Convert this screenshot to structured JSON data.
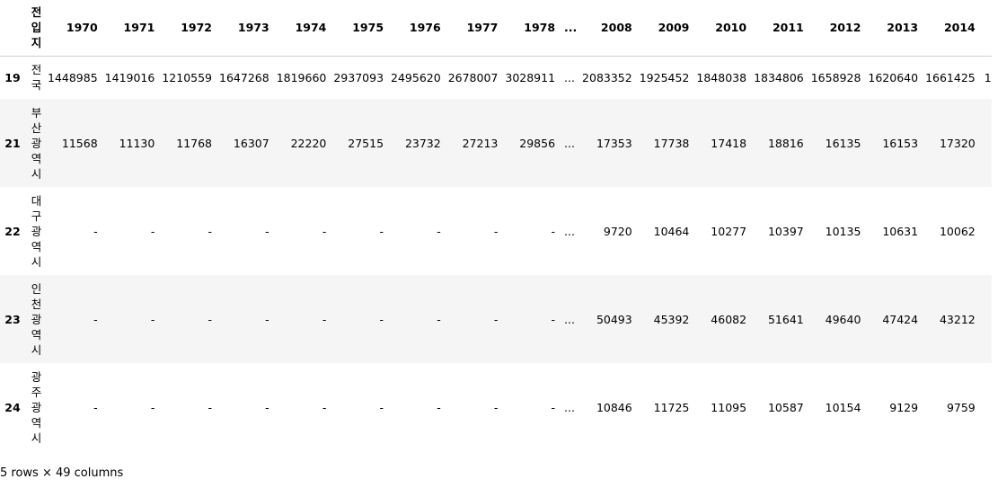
{
  "table": {
    "index_header": "",
    "name_header": "전입지",
    "columns_left": [
      "1970",
      "1971",
      "1972",
      "1973",
      "1974",
      "1975",
      "1976",
      "1977",
      "1978"
    ],
    "ellipsis": "...",
    "columns_right": [
      "2008",
      "2009",
      "2010",
      "2011",
      "2012",
      "2013",
      "2014"
    ],
    "rows": [
      {
        "index": "19",
        "name": "전국",
        "left": [
          "1448985",
          "1419016",
          "1210559",
          "1647268",
          "1819660",
          "2937093",
          "2495620",
          "2678007",
          "3028911"
        ],
        "right": [
          "2083352",
          "1925452",
          "1848038",
          "1834806",
          "1658928",
          "1620640",
          "1661425"
        ],
        "overflow": "1"
      },
      {
        "index": "21",
        "name": "부산광역시",
        "left": [
          "11568",
          "11130",
          "11768",
          "16307",
          "22220",
          "27515",
          "23732",
          "27213",
          "29856"
        ],
        "right": [
          "17353",
          "17738",
          "17418",
          "18816",
          "16135",
          "16153",
          "17320"
        ],
        "overflow": ""
      },
      {
        "index": "22",
        "name": "대구광역시",
        "left": [
          "-",
          "-",
          "-",
          "-",
          "-",
          "-",
          "-",
          "-",
          "-"
        ],
        "right": [
          "9720",
          "10464",
          "10277",
          "10397",
          "10135",
          "10631",
          "10062"
        ],
        "overflow": ""
      },
      {
        "index": "23",
        "name": "인천광역시",
        "left": [
          "-",
          "-",
          "-",
          "-",
          "-",
          "-",
          "-",
          "-",
          "-"
        ],
        "right": [
          "50493",
          "45392",
          "46082",
          "51641",
          "49640",
          "47424",
          "43212"
        ],
        "overflow": ""
      },
      {
        "index": "24",
        "name": "광주광역시",
        "left": [
          "-",
          "-",
          "-",
          "-",
          "-",
          "-",
          "-",
          "-",
          "-"
        ],
        "right": [
          "10846",
          "11725",
          "11095",
          "10587",
          "10154",
          "9129",
          "9759"
        ],
        "overflow": ""
      }
    ]
  },
  "footer": {
    "shape_text": "5 rows × 49 columns"
  }
}
